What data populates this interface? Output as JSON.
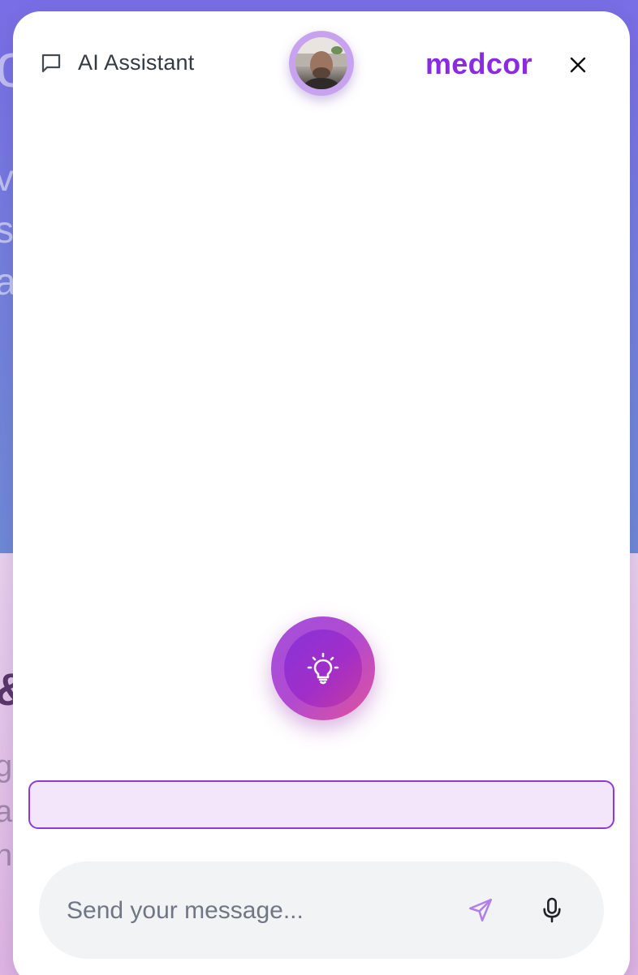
{
  "background_text": {
    "line1": "o",
    "line2": "v",
    "line3": "s",
    "line4": "a",
    "line5": "&",
    "line6": "g",
    "line7": "ag",
    "line8": "h"
  },
  "header": {
    "title": "AI Assistant",
    "brand": "medcor",
    "chat_icon": "message-square-icon",
    "close_icon": "close-icon",
    "avatar": "user-avatar"
  },
  "orb": {
    "icon": "lightbulb-icon"
  },
  "status_bar": {
    "text": ""
  },
  "composer": {
    "placeholder": "Send your message...",
    "value": "",
    "send_icon": "send-icon",
    "mic_icon": "microphone-icon"
  },
  "colors": {
    "brand": "#8a2be2",
    "accent": "#8b3cd8",
    "status_fill": "#f3e6fa",
    "composer_bg": "#f2f3f5"
  }
}
